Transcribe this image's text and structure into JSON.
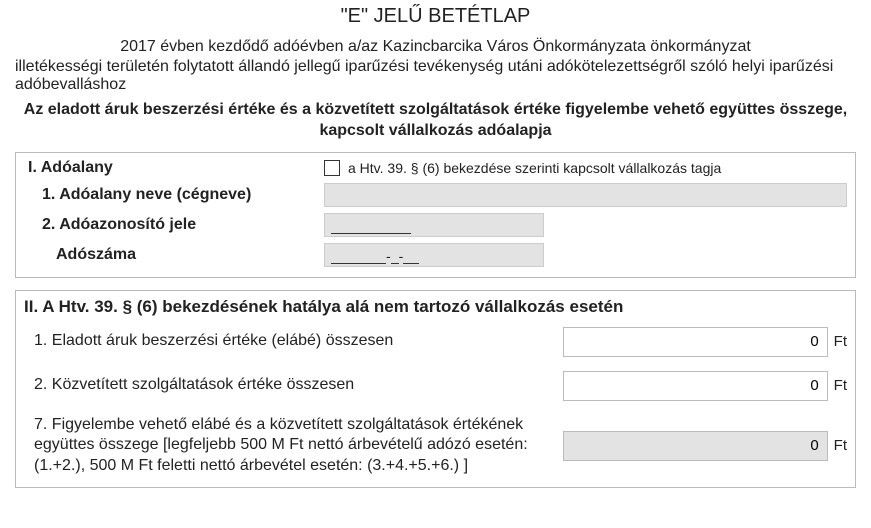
{
  "title": "\"E\" JELŰ BETÉTLAP",
  "intro_line1": "2017 évben kezdődő adóévben a/az Kazincbarcika Város Önkormányzata önkormányzat",
  "intro_line2": "illetékességi területén folytatott állandó jellegű iparűzési tevékenység utáni adókötelezettségről szóló helyi iparűzési adóbevalláshoz",
  "bold_heading": "Az eladott áruk beszerzési értéke és a közvetített szolgáltatások értéke figyelembe vehető együttes összege, kapcsolt vállalkozás adóalapja",
  "section1": {
    "title": "I. Adóalany",
    "checkbox_label": "a Htv. 39. § (6) bekezdése szerinti kapcsolt vállalkozás tagja",
    "row1_label": "1. Adóalany neve (cégneve)",
    "row2_label": "2. Adóazonosító jele",
    "row3_label": "Adószáma",
    "adoszam_placeholder": "________-_-__"
  },
  "section2": {
    "title": "II. A Htv. 39. § (6) bekezdésének hatálya alá nem tartozó vállalkozás esetén",
    "row1_label": "1. Eladott áruk beszerzési értéke (elábé) összesen",
    "row1_value": "0",
    "row2_label": "2. Közvetített szolgáltatások értéke összesen",
    "row2_value": "0",
    "row7_label": "7. Figyelembe vehető elábé és a közvetített szolgáltatások értékének együttes összege [legfeljebb 500 M Ft nettó árbevételű adózó esetén: (1.+2.), 500 M Ft feletti nettó árbevétel esetén: (3.+4.+5.+6.) ]",
    "row7_value": "0",
    "unit": "Ft"
  }
}
